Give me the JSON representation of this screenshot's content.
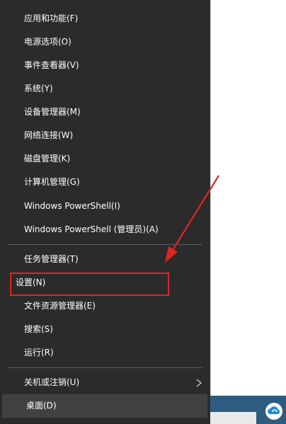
{
  "menu": {
    "group1": [
      "应用和功能(F)",
      "电源选项(O)",
      "事件查看器(V)",
      "系统(Y)",
      "设备管理器(M)",
      "网络连接(W)",
      "磁盘管理(K)",
      "计算机管理(G)",
      "Windows PowerShell(I)",
      "Windows PowerShell (管理员)(A)"
    ],
    "group2": [
      "任务管理器(T)",
      "设置(N)",
      "文件资源管理器(E)",
      "搜索(S)",
      "运行(R)"
    ],
    "group3": [
      "关机或注销(U)",
      "桌面(D)"
    ]
  },
  "colors": {
    "menu_bg": "#2b2b2b",
    "highlight": "#e02424",
    "taskbar": "#2d5c80"
  },
  "icons": {
    "submenu": "chevron-right-icon",
    "tray": "cloud-icon"
  }
}
